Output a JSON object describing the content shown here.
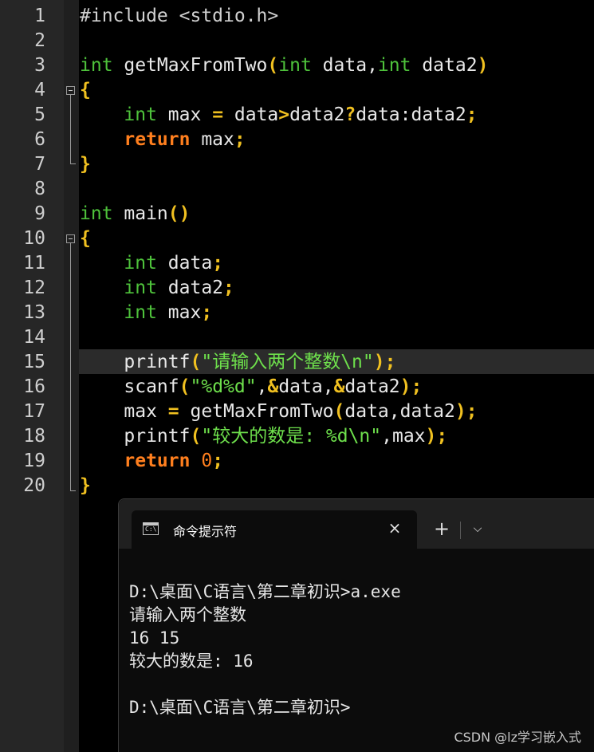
{
  "editor": {
    "line_numbers": [
      "1",
      "2",
      "3",
      "4",
      "5",
      "6",
      "7",
      "8",
      "9",
      "10",
      "11",
      "12",
      "13",
      "14",
      "15",
      "16",
      "17",
      "18",
      "19",
      "20"
    ],
    "code": {
      "l1": "#include <stdio.h>",
      "l3": {
        "kw1": "int",
        "t1": " getMaxFromTwo",
        "p1": "(",
        "kw2": "int",
        "t2": " data,",
        "kw3": "int",
        "t3": " data2",
        "p2": ")"
      },
      "l4": "{",
      "l5": {
        "indent": "    ",
        "kw": "int",
        "t1": " max ",
        "op1": "=",
        "t2": " data",
        "op2": ">",
        "t3": "data2",
        "op3": "?",
        "t4": "data:data2",
        "op4": ";"
      },
      "l6": {
        "indent": "    ",
        "kw": "return",
        "t": " max",
        "op": ";"
      },
      "l7": "}",
      "l9": {
        "kw": "int",
        "t": " main",
        "p": "()"
      },
      "l10": "{",
      "l11": {
        "indent": "    ",
        "kw": "int",
        "t": " data",
        "op": ";"
      },
      "l12": {
        "indent": "    ",
        "kw": "int",
        "t": " data2",
        "op": ";"
      },
      "l13": {
        "indent": "    ",
        "kw": "int",
        "t": " max",
        "op": ";"
      },
      "l15": {
        "indent": "    ",
        "t": "printf",
        "p1": "(",
        "s": "\"请输入两个整数\\n\"",
        "p2": ");"
      },
      "l16": {
        "indent": "    ",
        "t": "scanf",
        "p1": "(",
        "s": "\"%d%d\"",
        "t2": ",",
        "a1": "&",
        "t3": "data,",
        "a2": "&",
        "t4": "data2",
        "p2": ");"
      },
      "l17": {
        "indent": "    ",
        "t": "max ",
        "op": "=",
        "t2": " getMaxFromTwo",
        "p1": "(",
        "t3": "data,data2",
        "p2": ");"
      },
      "l18": {
        "indent": "    ",
        "t": "printf",
        "p1": "(",
        "s": "\"较大的数是: %d\\n\"",
        "t2": ",max",
        "p2": ");"
      },
      "l19": {
        "indent": "    ",
        "kw": "return",
        "num": " 0",
        "op": ";"
      },
      "l20": "}"
    }
  },
  "terminal": {
    "tab_title": "命令提示符",
    "tab_icon": "cmd-icon",
    "close_icon": "×",
    "new_tab_icon": "+",
    "dropdown_icon": "⌵",
    "lines": [
      "D:\\桌面\\C语言\\第二章初识>a.exe",
      "请输入两个整数",
      "16 15",
      "较大的数是: 16",
      "",
      "D:\\桌面\\C语言\\第二章初识>"
    ]
  },
  "watermark": "CSDN @lz学习嵌入式"
}
